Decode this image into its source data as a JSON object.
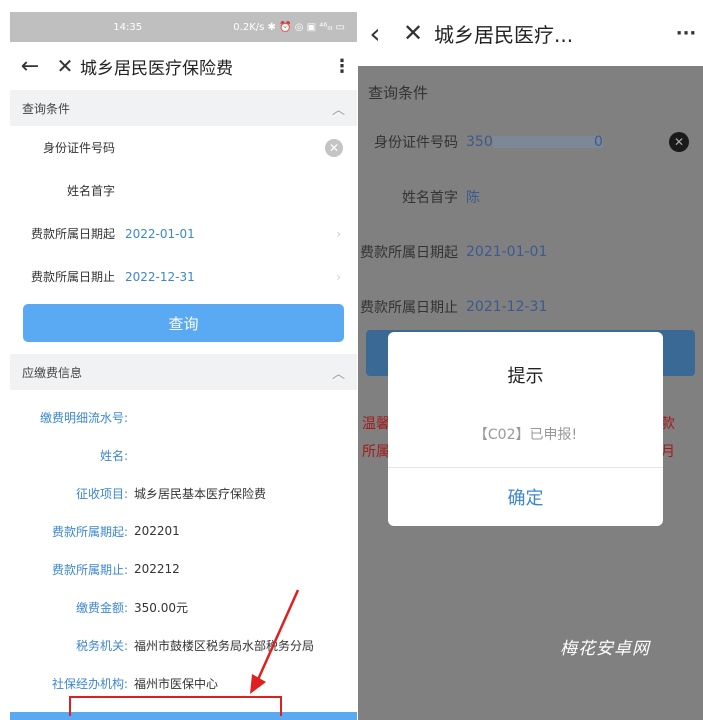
{
  "left": {
    "statusbar": {
      "time": "14:35",
      "indicators": "0.2K/s ✱ ⏰ ◎ ▣ ⁴⁶ᵢₗₗ ▭"
    },
    "header": {
      "back_icon": "←",
      "close_icon": "✕",
      "title": "城乡居民医疗保险费",
      "more_icon": "⋮"
    },
    "query_section": {
      "title": "查询条件",
      "fields": [
        {
          "label": "身份证件号码",
          "value": ""
        },
        {
          "label": "姓名首字",
          "value": ""
        },
        {
          "label": "费款所属日期起",
          "value": "2022-01-01"
        },
        {
          "label": "费款所属日期止",
          "value": "2022-12-31"
        }
      ],
      "query_button": "查询"
    },
    "payable_section": {
      "title": "应缴费信息",
      "rows": [
        {
          "label": "缴费明细流水号:",
          "value": ""
        },
        {
          "label": "姓名:",
          "value": ""
        },
        {
          "label": "征收项目:",
          "value": "城乡居民基本医疗保险费"
        },
        {
          "label": "费款所属期起:",
          "value": "202201"
        },
        {
          "label": "费款所属期止:",
          "value": "202212"
        },
        {
          "label": "缴费金额:",
          "value": "350.00元"
        },
        {
          "label": "税务机关:",
          "value": "福州市鼓楼区税务局水部税务分局"
        },
        {
          "label": "社保经办机构:",
          "value": "福州市医保中心"
        }
      ]
    }
  },
  "right": {
    "header": {
      "back_icon": "‹",
      "close_icon": "✕",
      "title": "城乡居民医疗...",
      "more_icon": "···"
    },
    "query_section": {
      "title": "查询条件",
      "fields": [
        {
          "label": "身份证件号码",
          "value": "350",
          "value_tail": "0"
        },
        {
          "label": "姓名首字",
          "value": "陈"
        },
        {
          "label": "费款所属日期起",
          "value": "2021-01-01"
        },
        {
          "label": "费款所属日期止",
          "value": "2021-12-31"
        }
      ]
    },
    "warning_left": [
      "温馨",
      "所属"
    ],
    "warning_right": [
      "款",
      "月"
    ],
    "dialog": {
      "title": "提示",
      "message": "【C02】已申报!",
      "ok": "确定"
    }
  },
  "watermark": "梅花安卓网",
  "colors": {
    "accent": "#5aaaf3",
    "link": "#3c87d0",
    "alert": "#e02020"
  }
}
